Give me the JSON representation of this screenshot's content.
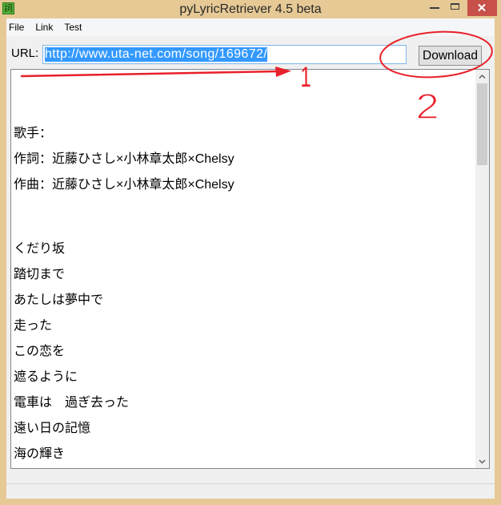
{
  "window": {
    "title": "pyLyricRetriever 4.5 beta",
    "icon_glyph": "詞",
    "controls": [
      "minimize-icon",
      "maximize-icon",
      "close-icon"
    ]
  },
  "colors": {
    "window_frame": "#e6c995",
    "close_button": "#c7504b",
    "selection": "#3399ff",
    "annotation": "#e8202a"
  },
  "menu": {
    "items": [
      "File",
      "Link",
      "Test"
    ]
  },
  "url_bar": {
    "label": "URL:",
    "value": "http://www.uta-net.com/song/169672/",
    "value_selected": true
  },
  "download_button": {
    "label": "Download"
  },
  "lyrics_box": {
    "text": "\n\n\n\n歌手：\n\n作詞：近藤ひさし×小林章太郎×Chelsy\n\n作曲：近藤ひさし×小林章太郎×Chelsy\n\n\n\n\nくだり坂\n\n踏切まで\n\nあたしは夢中で\n\n走った\n\nこの恋を\n\n遮るように\n\n電車は　過ぎ去った\n\n遠い日の記憶\n\n海の輝き",
    "scrollbar": {
      "position": 0,
      "visible_fraction": 0.22
    }
  },
  "annotations": {
    "step_1": "1",
    "step_2": "2"
  }
}
